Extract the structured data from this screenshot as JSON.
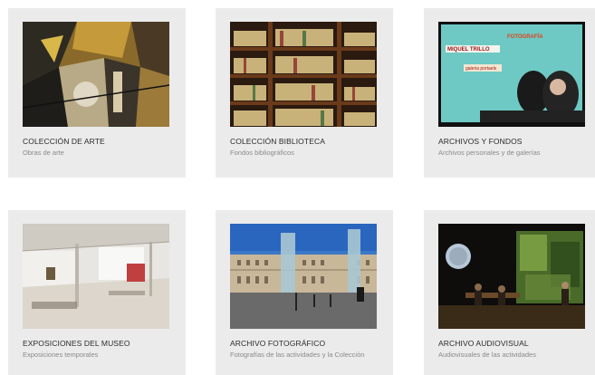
{
  "cards": [
    {
      "title": "COLECCIÓN DE ARTE",
      "subtitle": "Obras de arte",
      "image": "cubist-painting"
    },
    {
      "title": "COLECCIÓN BIBLIOTECA",
      "subtitle": "Fondos bibliográficos",
      "image": "library-shelves"
    },
    {
      "title": "ARCHIVOS Y FONDOS",
      "subtitle": "Archivos personales y de galerías",
      "image": "archive-photo",
      "image_text": {
        "name": "MIQUEL TRILLO",
        "word": "FOTOGRAFÍA",
        "caption": "galeria portaels"
      }
    },
    {
      "title": "EXPOSICIONES DEL MUSEO",
      "subtitle": "Exposiciones temporales",
      "image": "museum-gallery"
    },
    {
      "title": "ARCHIVO FOTOGRÁFICO",
      "subtitle": "Fotografías de las actividades y la Colección",
      "image": "museum-building"
    },
    {
      "title": "ARCHIVO AUDIOVISUAL",
      "subtitle": "Audiovisuales de las actividades",
      "image": "audiovisual-stage"
    }
  ]
}
